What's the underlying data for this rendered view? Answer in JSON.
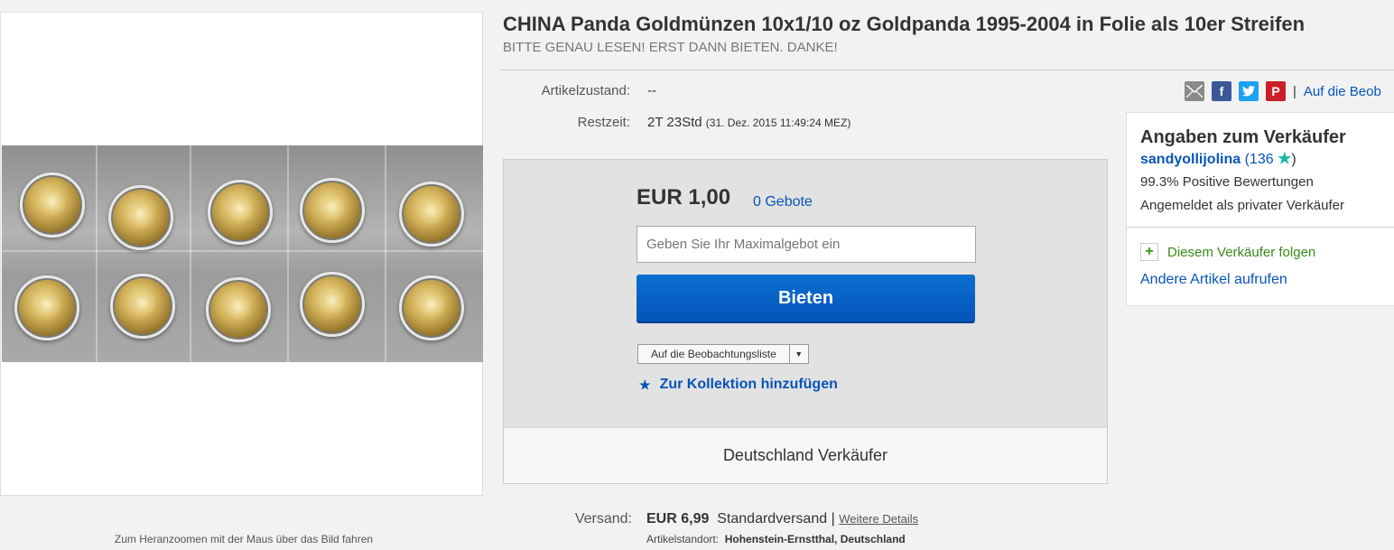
{
  "listing": {
    "title": "CHINA Panda Goldmünzen 10x1/10 oz Goldpanda 1995-2004 in Folie als 10er Streifen",
    "subtitle": "BITTE GENAU LESEN! ERST DANN BIETEN. DANKE!",
    "zoom_hint": "Zum Heranzoomen mit der Maus über das Bild fahren"
  },
  "details": {
    "condition_label": "Artikelzustand:",
    "condition_value": "--",
    "time_label": "Restzeit:",
    "time_value": "2T 23Std",
    "time_end": "(31. Dez. 2015   11:49:24 MEZ)"
  },
  "share": {
    "icons": [
      "email-icon",
      "facebook-icon",
      "twitter-icon",
      "pinterest-icon"
    ],
    "separator": "|",
    "watch_link": "Auf die Beob"
  },
  "bid": {
    "price": "EUR 1,00",
    "bids_count": "0 Gebote",
    "max_bid_placeholder": "Geben Sie Ihr Maximalgebot ein",
    "bid_button": "Bieten",
    "watchlist_dropdown": "Auf die Beobachtungsliste",
    "collection_link": "Zur Kollektion hinzufügen",
    "seller_country": "Deutschland Verkäufer"
  },
  "seller": {
    "heading": "Angaben zum Verkäufer",
    "username": "sandyollijolina",
    "rating_open": "(136",
    "rating_close": ")",
    "positive": "99.3% Positive Bewertungen",
    "type": "Angemeldet als privater Verkäufer",
    "follow": "Diesem Verkäufer folgen",
    "other_items": "Andere Artikel aufrufen"
  },
  "shipping": {
    "label": "Versand:",
    "cost": "EUR 6,99",
    "method": "Standardversand",
    "separator": "|",
    "details_link": "Weitere Details",
    "location_label": "Artikelstandort:",
    "location": "Hohenstein-Ernstthal, Deutschland"
  },
  "colors": {
    "link_blue": "#0654ba",
    "button_blue": "#0654ba",
    "facebook": "#3b5998",
    "twitter": "#1da1f2",
    "pinterest": "#cb2027",
    "follow_green": "#3a8a1a",
    "star_teal": "#1fb8a8"
  }
}
